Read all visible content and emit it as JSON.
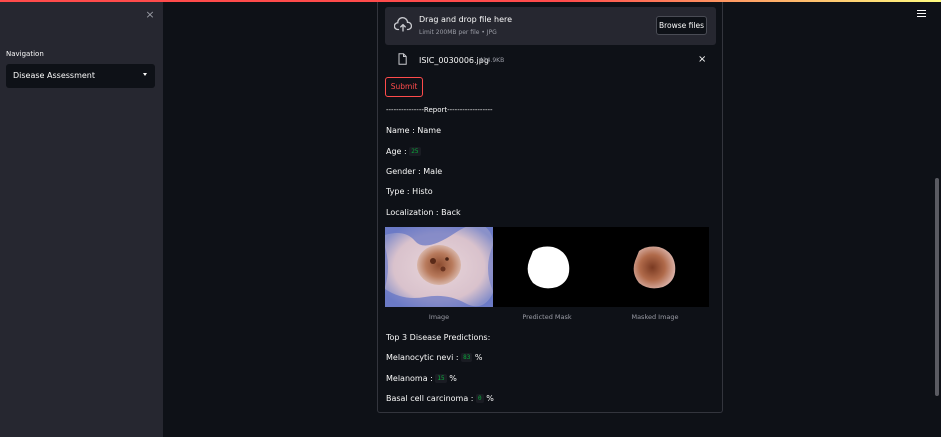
{
  "sidebar": {
    "close_glyph": "×",
    "nav_label": "Navigation",
    "selected_page": "Disease Assessment"
  },
  "uploader": {
    "title": "Drag and drop file here",
    "subtitle": "Limit 200MB per file • JPG",
    "browse_label": "Browse files",
    "file_name": "ISIC_0030006.jpg",
    "file_size": "414.9KB",
    "remove_glyph": "×"
  },
  "form": {
    "submit_label": "Submit"
  },
  "report": {
    "header": "---------------Report------------------",
    "name_label": "Name :",
    "name_value": "Name",
    "age_label": "Age :",
    "age_value": "25",
    "gender_label": "Gender :",
    "gender_value": "Male",
    "type_label": "Type :",
    "type_value": "Histo",
    "localization_label": "Localization :",
    "localization_value": "Back"
  },
  "images": {
    "captions": [
      "Image",
      "Predicted Mask",
      "Masked Image"
    ]
  },
  "predictions": {
    "title": "Top 3 Disease Predictions:",
    "items": [
      {
        "label": "Melanocytic nevi :",
        "value": "83",
        "unit": "%"
      },
      {
        "label": "Melanoma :",
        "value": "15",
        "unit": "%"
      },
      {
        "label": "Basal cell carcinoma :",
        "value": "0",
        "unit": "%"
      }
    ]
  },
  "colors": {
    "accent": "#ff4b4b",
    "badge_text": "#09ab3b",
    "background": "#0e1117",
    "sidebar": "#262730"
  }
}
